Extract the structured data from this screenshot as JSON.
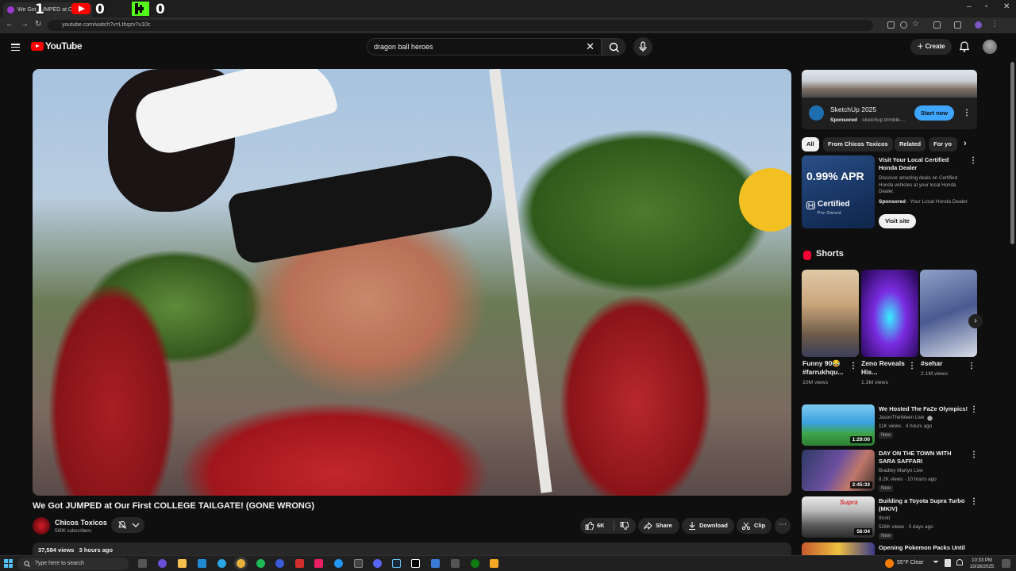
{
  "browser": {
    "tab_title": "We Got JUMPED at Our F",
    "overlay_counter_1": "1",
    "overlay_counter_2": "0",
    "overlay_counter_3": "0",
    "url": "youtube.com/watch?v=Lthqzv7u10c"
  },
  "header": {
    "logo_text": "YouTube",
    "search_value": "dragon ball heroes",
    "create_label": "Create"
  },
  "video": {
    "title": "We Got JUMPED at Our First COLLEGE TAILGATE! (GONE WRONG)",
    "channel_name": "Chicos Toxicos",
    "subscribers": "580K subscribers",
    "likes": "6K",
    "share_label": "Share",
    "download_label": "Download",
    "clip_label": "Clip",
    "views": "37,584 views",
    "published": "3 hours ago"
  },
  "sidebar": {
    "ad": {
      "title": "SketchUp 2025",
      "sponsored": "Sponsored",
      "domain": "· sketchup.trimble....",
      "cta": "Start now"
    },
    "chips": [
      "All",
      "From Chicos Toxicos",
      "Related",
      "For yo"
    ],
    "honda_ad": {
      "apr": "0.99% APR",
      "certified": "Certified",
      "pre_owned": "Pre-Owned",
      "title": "Visit Your Local Certified Honda Dealer",
      "description": "Discover amazing deals on Certified Honda vehicles at your local Honda Dealer.",
      "sponsored": "Sponsored",
      "advertiser": "· Your Local Honda Dealer",
      "cta": "Visit site"
    },
    "shorts_heading": "Shorts",
    "shorts": [
      {
        "title": "Funny 90😂 #farrukhqu...",
        "views": "10M views"
      },
      {
        "title": "Zeno Reveals His...",
        "views": "1.3M views"
      },
      {
        "title": "#sehar",
        "views": "2.1M views"
      }
    ],
    "recommended": [
      {
        "title": "We Hosted The FaZe Olympics!",
        "channel": "JasonTheWeen Live",
        "meta": "11K views · 4 hours ago",
        "duration": "1:29:00",
        "badge": "New"
      },
      {
        "title": "DAY ON THE TOWN WITH SARA SAFFARI",
        "channel": "Bradley Martyn Live",
        "meta": "8.2K views · 10 hours ago",
        "duration": "2:45:33",
        "badge": "New"
      },
      {
        "title": "Building a Toyota Supra Turbo (MKIV)",
        "channel": "throtl",
        "meta": "526K views · 5 days ago",
        "duration": "56:04",
        "badge": "New"
      },
      {
        "title": "Opening Pokemon Packs Until I",
        "channel": "",
        "meta": "",
        "duration": "",
        "badge": ""
      }
    ]
  },
  "taskbar": {
    "search_placeholder": "Type here to search",
    "weather": "55°F  Clear",
    "time": "10:33 PM",
    "date": "10/16/2025"
  },
  "colors": {
    "background": "#0f0f0f",
    "accent_blue": "#3ea6ff",
    "youtube_red": "#ff0000"
  }
}
